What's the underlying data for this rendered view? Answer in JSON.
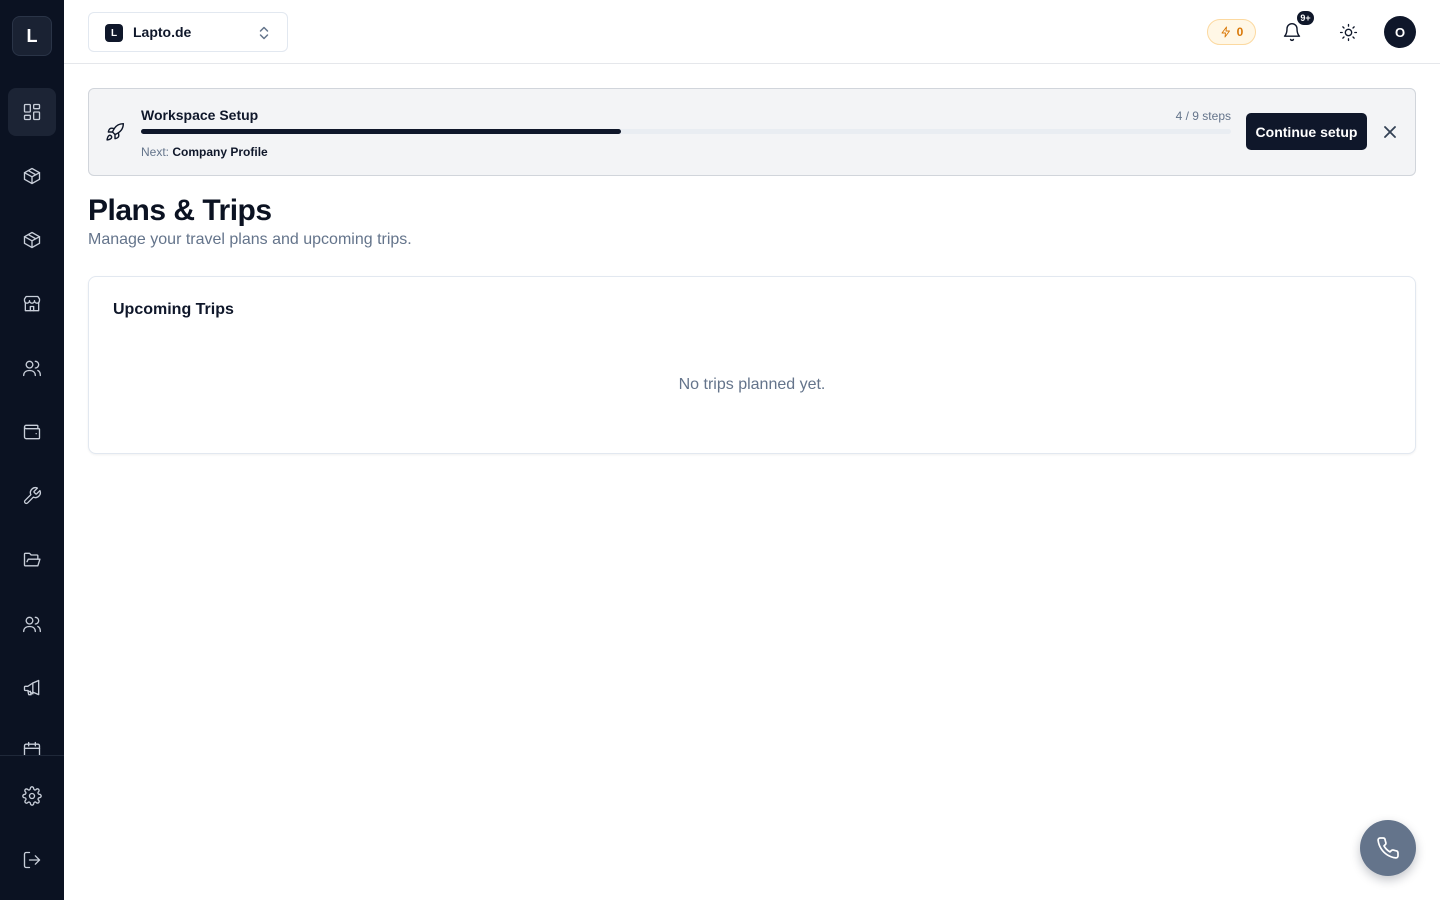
{
  "brand": {
    "letter": "L"
  },
  "sidebar": {
    "items": [
      {
        "icon": "dashboard-grid-icon",
        "active": true
      },
      {
        "icon": "package-icon"
      },
      {
        "icon": "package-icon"
      },
      {
        "icon": "store-icon"
      },
      {
        "icon": "users-icon"
      },
      {
        "icon": "wallet-icon"
      },
      {
        "icon": "wrench-icon"
      },
      {
        "icon": "folder-open-icon"
      },
      {
        "icon": "users-icon"
      },
      {
        "icon": "megaphone-icon"
      },
      {
        "icon": "calendar-icon"
      }
    ],
    "bottom": [
      {
        "icon": "gear-icon"
      },
      {
        "icon": "logout-icon"
      }
    ]
  },
  "topbar": {
    "workspace": {
      "badge": "L",
      "name": "Lapto.de"
    },
    "credits": "0",
    "notifications_badge": "9+",
    "avatar_initial": "O"
  },
  "setup": {
    "title": "Workspace Setup",
    "steps_text": "4 / 9 steps",
    "progress_fraction": 0.44,
    "next_label": "Next:",
    "next_value": "Company Profile",
    "continue_label": "Continue setup"
  },
  "page": {
    "title": "Plans & Trips",
    "subtitle": "Manage your travel plans and upcoming trips."
  },
  "trips_card": {
    "title": "Upcoming Trips",
    "empty_text": "No trips planned yet."
  },
  "colors": {
    "sidebar_bg": "#0b1222",
    "primary": "#0f172a",
    "accent_orange": "#d97706",
    "fab_bg": "#64748b"
  }
}
